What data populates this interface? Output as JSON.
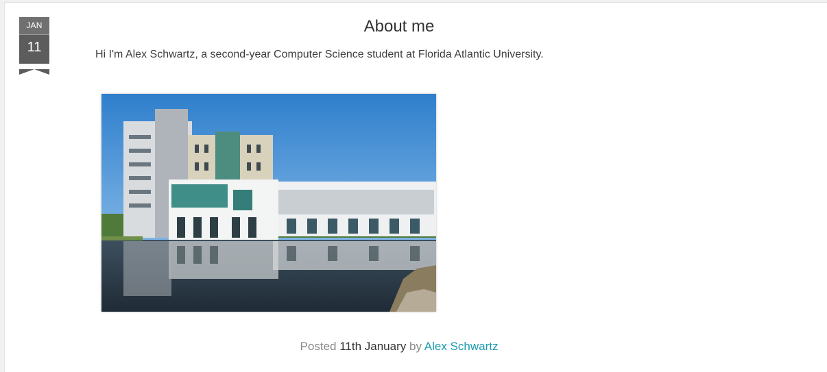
{
  "post": {
    "date": {
      "month": "JAN",
      "day": "11"
    },
    "title": "About me",
    "intro": "Hi I'm Alex Schwartz, a second-year Computer Science student at Florida Atlantic University.",
    "image": {
      "subject": "modern university building reflected in a pond"
    },
    "meta": {
      "posted_label": "Posted",
      "date": "11th January",
      "by_label": "by",
      "author": "Alex Schwartz"
    }
  },
  "colors": {
    "accent_link": "#1b9bb0",
    "ribbon": "#5c5c5c",
    "title_text": "#333333"
  }
}
